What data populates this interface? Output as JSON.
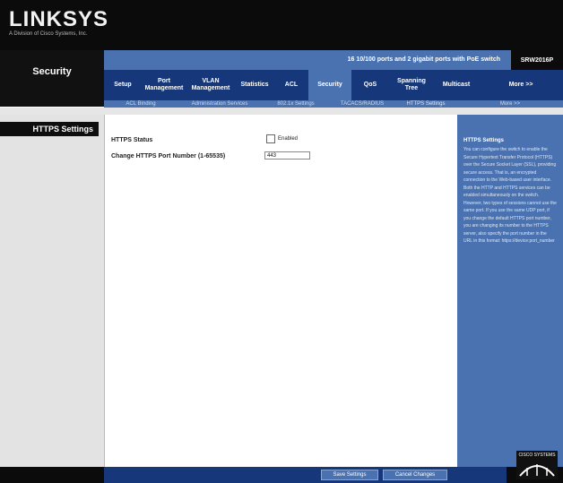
{
  "brand": {
    "logo": "LINKSYS",
    "sub": "A Division of Cisco Systems, Inc."
  },
  "section_title": "Security",
  "product": {
    "description": "16 10/100 ports and 2 gigabit ports with PoE switch",
    "model": "SRW2016P"
  },
  "tabs": [
    {
      "label": "Setup"
    },
    {
      "label": "Port\nManagement"
    },
    {
      "label": "VLAN\nManagement"
    },
    {
      "label": "Statistics"
    },
    {
      "label": "ACL"
    },
    {
      "label": "Security"
    },
    {
      "label": "QoS"
    },
    {
      "label": "Spanning\nTree"
    },
    {
      "label": "Multicast"
    },
    {
      "label": "More >>"
    }
  ],
  "subtabs": [
    {
      "label": "ACL Binding"
    },
    {
      "label": "Administration Services"
    },
    {
      "label": "802.1x Settings"
    },
    {
      "label": "TACACS/RADIUS"
    },
    {
      "label": "HTTPS Settings"
    },
    {
      "label": "More >>"
    }
  ],
  "sidebar": {
    "active_item": "HTTPS Settings"
  },
  "form": {
    "https_status_label": "HTTPS Status",
    "https_status_checkbox_label": "Enabled",
    "port_label": "Change HTTPS Port Number (1-65535)",
    "port_value": "443"
  },
  "help": {
    "title": "HTTPS Settings",
    "body": "You can configure the switch to enable the Secure Hypertext Transfer Protocol (HTTPS) over the Secure Socket Layer (SSL), providing secure access. That is, an encrypted connection to the Web-based user interface. Both the HTTP and HTTPS services can be enabled simultaneously on the switch. However, two types of sessions cannot use the same port. If you use the same UDP port, if you change the default HTTPS port number, you are changing its number to the HTTPS server, also specify the port number in the URL in this format: https://device:port_number"
  },
  "footer": {
    "save": "Save Settings",
    "cancel": "Cancel Changes",
    "cisco": "CISCO SYSTEMS"
  }
}
